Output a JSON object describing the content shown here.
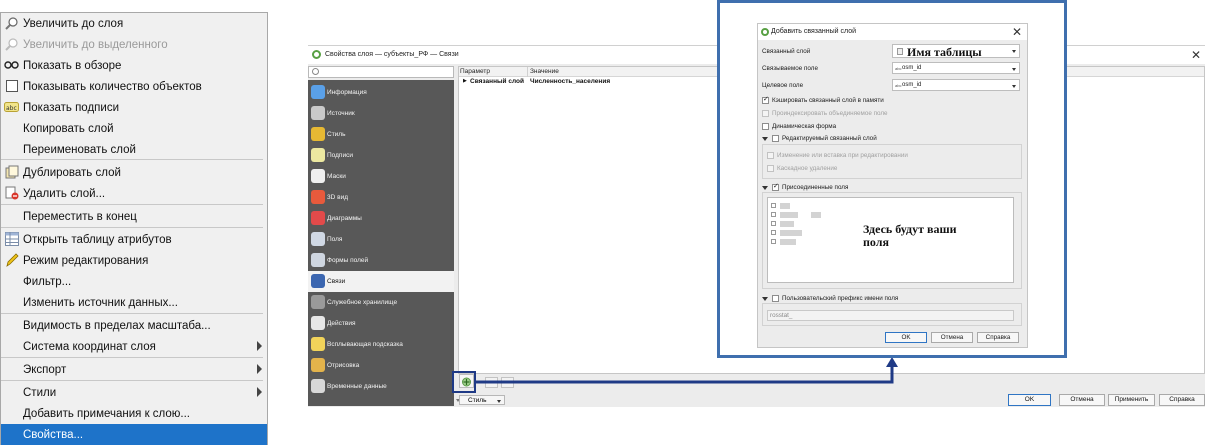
{
  "context_menu": {
    "items": [
      {
        "label": "Увеличить до слоя",
        "icon": "zoom-to-layer-icon",
        "disabled": false
      },
      {
        "label": "Увеличить до выделенного",
        "icon": "zoom-to-selection-icon",
        "disabled": true
      },
      {
        "label": "Показать в обзоре",
        "icon": "show-in-overview-icon",
        "disabled": false
      },
      {
        "label": "Показывать количество объектов",
        "icon": "checkbox-icon",
        "disabled": false
      },
      {
        "label": "Показать подписи",
        "icon": "labels-icon",
        "disabled": false
      },
      {
        "label": "Копировать слой",
        "icon": "",
        "disabled": false
      },
      {
        "label": "Переименовать слой",
        "icon": "",
        "disabled": false
      },
      {
        "label": "Дублировать слой",
        "icon": "duplicate-layer-icon",
        "disabled": false
      },
      {
        "label": "Удалить слой...",
        "icon": "remove-layer-icon",
        "disabled": false
      },
      {
        "label": "Переместить в конец",
        "icon": "",
        "disabled": false
      },
      {
        "label": "Открыть таблицу атрибутов",
        "icon": "attribute-table-icon",
        "disabled": false
      },
      {
        "label": "Режим редактирования",
        "icon": "pencil-icon",
        "disabled": false
      },
      {
        "label": "Фильтр...",
        "icon": "",
        "disabled": false
      },
      {
        "label": "Изменить источник данных...",
        "icon": "",
        "disabled": false
      },
      {
        "label": "Видимость в пределах масштаба...",
        "icon": "",
        "disabled": false
      },
      {
        "label": "Система координат слоя",
        "icon": "",
        "disabled": false,
        "submenu": true
      },
      {
        "label": "Экспорт",
        "icon": "",
        "disabled": false,
        "submenu": true
      },
      {
        "label": "Стили",
        "icon": "",
        "disabled": false,
        "submenu": true
      },
      {
        "label": "Добавить примечания к слою...",
        "icon": "",
        "disabled": false
      },
      {
        "label": "Свойства...",
        "icon": "",
        "disabled": false,
        "selected": true
      }
    ]
  },
  "properties_dialog": {
    "title": "Свойства слоя — субъекты_РФ — Связи",
    "sidebar": [
      {
        "label": "Информация",
        "icon": "info-icon",
        "color": "#5aa0e8"
      },
      {
        "label": "Источник",
        "icon": "source-icon",
        "color": "#c9c9c9"
      },
      {
        "label": "Стиль",
        "icon": "symbology-icon",
        "color": "#e6b833"
      },
      {
        "label": "Подписи",
        "icon": "labels-icon",
        "color": "#ece8a0"
      },
      {
        "label": "Маски",
        "icon": "masks-icon",
        "color": "#f0f0f0"
      },
      {
        "label": "3D вид",
        "icon": "3d-view-icon",
        "color": "#e85a3c"
      },
      {
        "label": "Диаграммы",
        "icon": "diagrams-icon",
        "color": "#e24a4a"
      },
      {
        "label": "Поля",
        "icon": "fields-icon",
        "color": "#d0d8e4"
      },
      {
        "label": "Формы полей",
        "icon": "attributes-form-icon",
        "color": "#cfd6e0"
      },
      {
        "label": "Связи",
        "icon": "joins-icon",
        "color": "#3b66b0",
        "active": true
      },
      {
        "label": "Служебное хранилище",
        "icon": "auxiliary-storage-icon",
        "color": "#9a9a9a"
      },
      {
        "label": "Действия",
        "icon": "actions-icon",
        "color": "#e6e6e6"
      },
      {
        "label": "Всплывающая подсказка",
        "icon": "display-icon",
        "color": "#f1d35a"
      },
      {
        "label": "Отрисовка",
        "icon": "rendering-icon",
        "color": "#e3b34b"
      },
      {
        "label": "Временные данные",
        "icon": "temporal-icon",
        "color": "#d8d8d8"
      }
    ],
    "table_headers": [
      "Параметр",
      "Значение"
    ],
    "table_row": {
      "param": "Связанный слой",
      "value": "Численность_населения"
    },
    "style_button": "Стиль",
    "buttons": {
      "ok": "OK",
      "cancel": "Отмена",
      "apply": "Применить",
      "help": "Справка"
    }
  },
  "join_dialog": {
    "title": "Добавить связанный слой",
    "fields": {
      "join_layer_label": "Связанный слой",
      "join_layer_value": "Имя таблицы",
      "join_field_label": "Связываемое поле",
      "join_field_value": "osm_id",
      "target_field_label": "Целевое поле",
      "target_field_value": "osm_id",
      "field_type": "abc"
    },
    "checkboxes": {
      "cache": "Кэшировать связанный слой в памяти",
      "index": "Проиндексировать объединяемое поле",
      "dynamic": "Динамическая форма",
      "editable": "Редактируемый связанный слой",
      "upsert": "Изменение или вставка при редактировании",
      "cascade": "Каскадное удаление",
      "subset": "Присоединенные поля",
      "prefix": "Пользовательский префикс имени поля"
    },
    "fields_note": "Здесь будут ваши поля",
    "prefix_value": "rosstat_",
    "buttons": {
      "ok": "OK",
      "cancel": "Отмена",
      "help": "Справка"
    }
  },
  "colors": {
    "accent": "#1e73c9",
    "highlight_border": "#1f3a86",
    "frame_border": "#3f6fae",
    "sidebar_bg": "#585858"
  }
}
